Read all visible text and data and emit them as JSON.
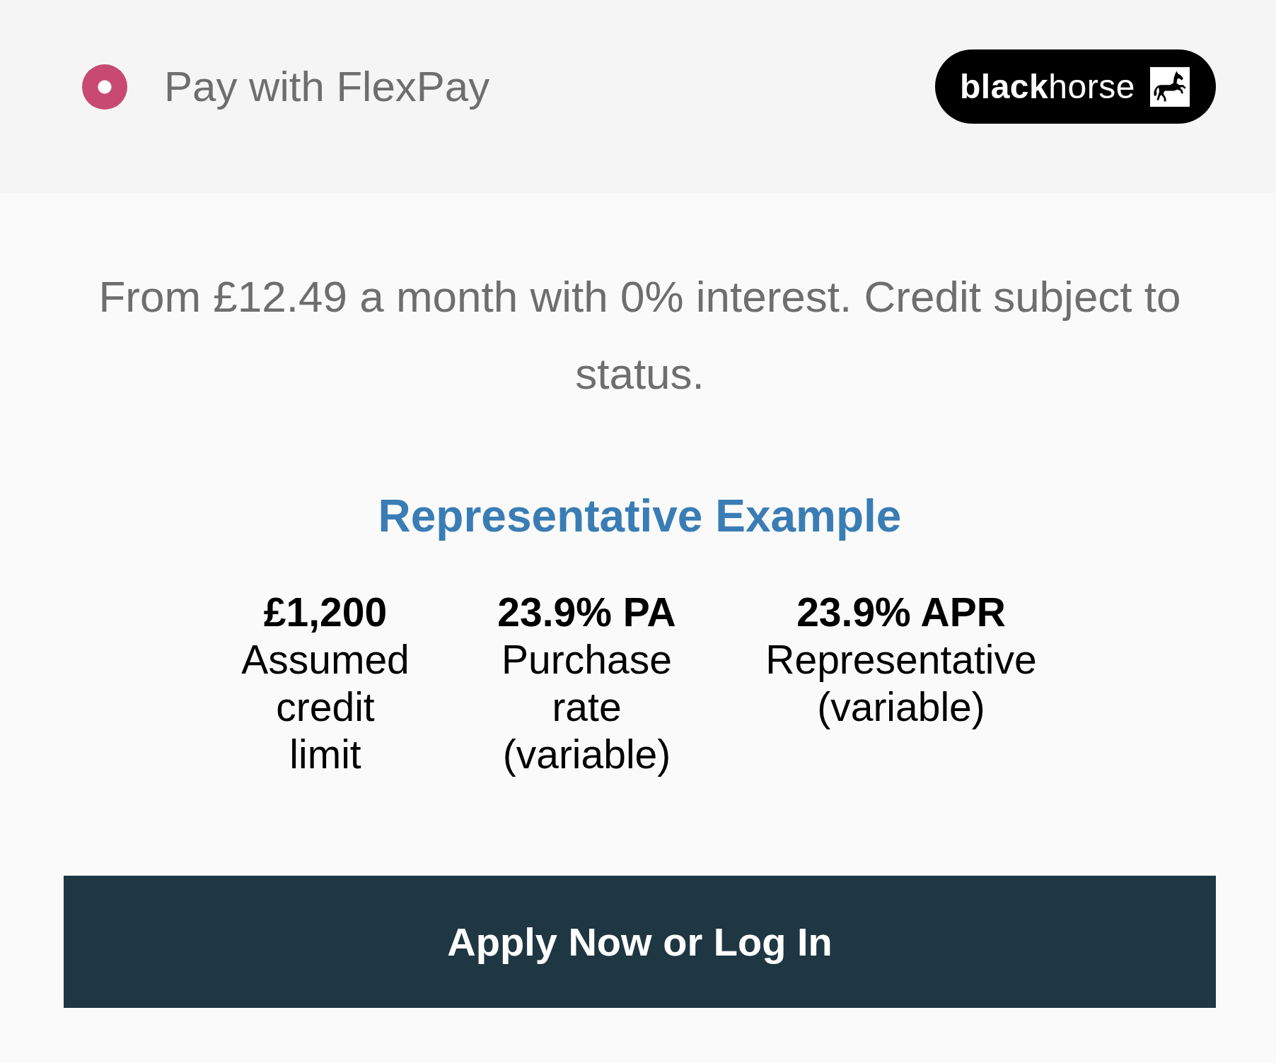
{
  "payment_option": {
    "label": "Pay with FlexPay",
    "selected": true
  },
  "provider_logo": {
    "text": "**black**horse"
  },
  "summary": "From £12.49 a month with 0% interest. Credit subject to status.",
  "representative_example": {
    "title": "Representative Example",
    "figures": [
      {
        "value": "£1,200",
        "label": "Assumed credit limit"
      },
      {
        "value": "23.9% PA",
        "label": "Purchase rate (variable)"
      },
      {
        "value": "23.9% APR",
        "label": "Representative (variable)"
      }
    ]
  },
  "action_button": {
    "label": "Apply Now or Log In"
  }
}
